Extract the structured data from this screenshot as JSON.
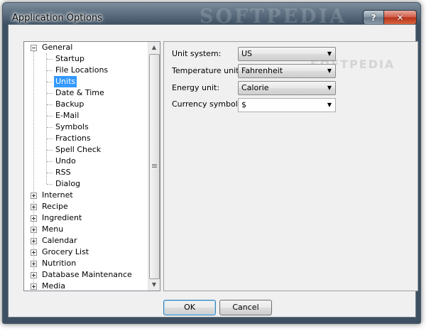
{
  "window": {
    "title": "Application Options",
    "watermark": "SOFTPEDIA"
  },
  "titlebar": {
    "help_glyph": "?",
    "close_glyph": "✕"
  },
  "tree": {
    "general": {
      "label": "General",
      "expander": "minus",
      "children": [
        "Startup",
        "File Locations",
        "Units",
        "Date & Time",
        "Backup",
        "E-Mail",
        "Symbols",
        "Fractions",
        "Spell Check",
        "Undo",
        "RSS",
        "Dialog"
      ],
      "selected": "Units"
    },
    "roots": [
      "Internet",
      "Recipe",
      "Ingredient",
      "Menu",
      "Calendar",
      "Grocery List",
      "Nutrition",
      "Database Maintenance",
      "Media"
    ]
  },
  "units_panel": {
    "watermark": "SOFTPEDIA",
    "unit_system": {
      "label": "Unit system:",
      "value": "US"
    },
    "temperature_unit": {
      "label": "Temperature unit:",
      "value": "Fahrenheit"
    },
    "energy_unit": {
      "label": "Energy unit:",
      "value": "Calorie"
    },
    "currency_symbol": {
      "label": "Currency symbol:",
      "value": "$"
    }
  },
  "buttons": {
    "ok": "OK",
    "cancel": "Cancel"
  },
  "icons": {
    "expand": "plus-box-icon",
    "collapse": "minus-box-icon",
    "dropdown": "chevron-down-icon",
    "scroll_up": "arrow-up-icon",
    "scroll_down": "arrow-down-icon"
  },
  "colors": {
    "selection": "#3399ff",
    "close_button": "#c7452d"
  }
}
